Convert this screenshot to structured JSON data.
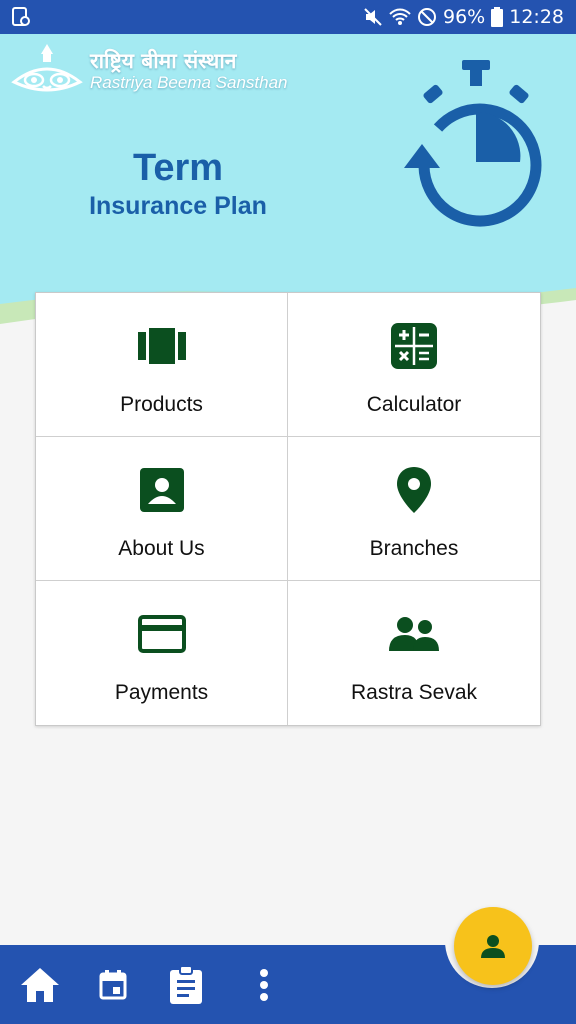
{
  "status_bar": {
    "battery": "96%",
    "time": "12:28"
  },
  "header": {
    "logo_devanagari": "राष्ट्रिय बीमा संस्थान",
    "logo_english": "Rastriya Beema Sansthan",
    "title_main": "Term",
    "title_sub": "Insurance Plan"
  },
  "menu": {
    "items": [
      {
        "label": "Products",
        "icon": "products-icon"
      },
      {
        "label": "Calculator",
        "icon": "calculator-icon"
      },
      {
        "label": "About Us",
        "icon": "contact-card-icon"
      },
      {
        "label": "Branches",
        "icon": "location-pin-icon"
      },
      {
        "label": "Payments",
        "icon": "credit-card-icon"
      },
      {
        "label": "Rastra Sevak",
        "icon": "people-icon"
      }
    ]
  },
  "bottom_nav": {
    "items": [
      "home-icon",
      "calendar-icon",
      "clipboard-icon",
      "more-vert-icon"
    ]
  },
  "fab": {
    "icon": "person-icon"
  },
  "colors": {
    "primary_blue": "#2453b0",
    "header_bg": "#a4eaf2",
    "icon_green": "#0b4f1f",
    "title_blue": "#1a5fa8",
    "fab_yellow": "#f7c21b"
  }
}
